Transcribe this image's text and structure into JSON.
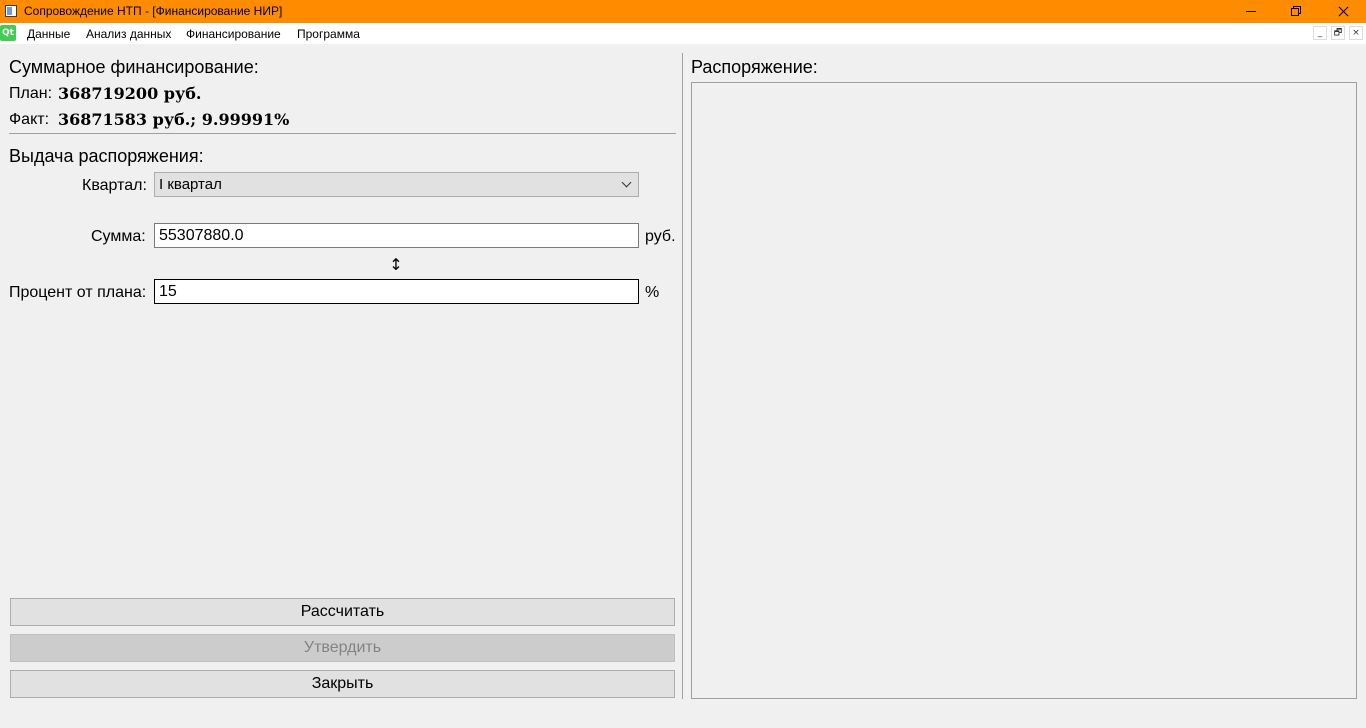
{
  "window": {
    "title": "Сопровождение НТП - [Финансирование НИР]",
    "app_logo": "Qt"
  },
  "icons": {
    "app": "app-window-icon",
    "swap": "vertical-swap-arrow-icon"
  },
  "menu": {
    "items": [
      "Данные",
      "Анализ данных",
      "Финансирование",
      "Программа"
    ]
  },
  "mdi_controls": [
    "_",
    "🗗",
    "×"
  ],
  "summary": {
    "heading": "Суммарное финансирование:",
    "plan_label": "План:",
    "plan_value": "368719200 руб.",
    "fact_label": "Факт:",
    "fact_value": "36871583 руб.; 9.99991%"
  },
  "order_form": {
    "heading": "Выдача распоряжения:",
    "quarter_label": "Квартал:",
    "quarter_selected": "I квартал",
    "sum_label": "Сумма:",
    "sum_value": "55307880.0",
    "sum_unit": "руб.",
    "swap_glyph": "↕",
    "percent_label": "Процент от плана:",
    "percent_value": "15",
    "percent_unit": "%"
  },
  "buttons": {
    "calculate": "Рассчитать",
    "approve": "Утвердить",
    "close": "Закрыть"
  },
  "order_panel": {
    "heading": "Распоряжение:"
  },
  "colors": {
    "titlebar": "#ff8c00",
    "qt_green": "#41cd52",
    "disabled_text": "#838383"
  }
}
